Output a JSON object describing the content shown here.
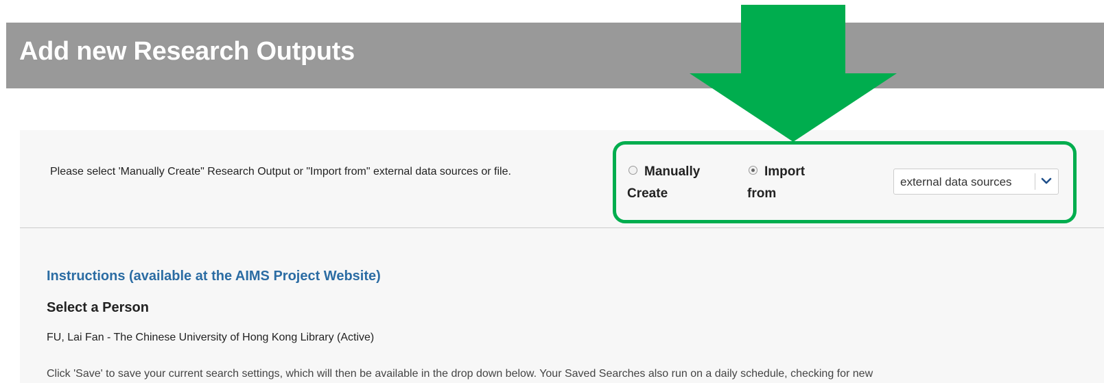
{
  "header": {
    "title": "Add new Research Outputs"
  },
  "form": {
    "prompt": "Please select 'Manually Create\" Research Output or \"Import from\" external data sources or file.",
    "options": {
      "manual": {
        "label_line1": "Manually",
        "label_line2": "Create",
        "checked": false
      },
      "import": {
        "label_line1": "Import",
        "label_line2": "from",
        "checked": true
      }
    },
    "source_select": {
      "value": "external data sources"
    }
  },
  "content": {
    "instructions_link": "Instructions (available at the AIMS Project Website)",
    "select_person_heading": "Select a Person",
    "person": "FU, Lai Fan - The Chinese University of Hong Kong Library (Active)",
    "save_note_partial": "Click 'Save' to save your current search settings, which will then be available in the drop down below. Your Saved Searches also run on a daily schedule, checking for new"
  },
  "annotation": {
    "color": "#00ad4e"
  }
}
